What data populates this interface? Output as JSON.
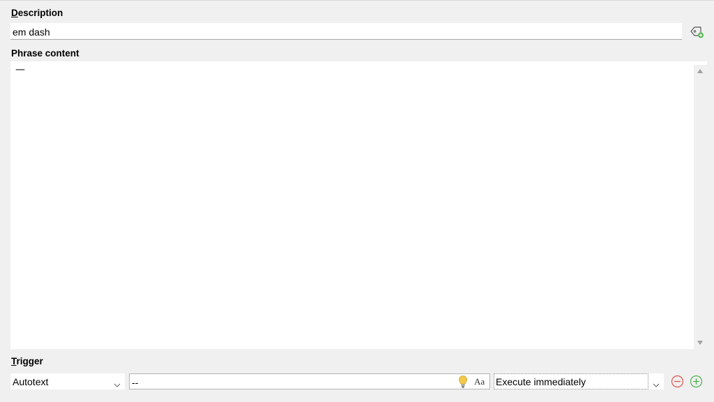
{
  "description": {
    "label_mnemonic": "D",
    "label_rest": "escription",
    "value": "em dash",
    "tag_icon": "tag-add-icon"
  },
  "phrase_content": {
    "label": "Phrase content",
    "text": "—"
  },
  "trigger": {
    "label_mnemonic": "T",
    "label_rest": "rigger",
    "type_value": "Autotext",
    "text_value": "--",
    "case_icon_text": "Aa",
    "execution_value": "Execute immediately",
    "remove_icon": "minus-circle-icon",
    "add_icon": "plus-circle-icon"
  },
  "colors": {
    "remove_red": "#e05050",
    "add_green": "#4caf50",
    "bulb_yellow": "#f2c94c"
  }
}
